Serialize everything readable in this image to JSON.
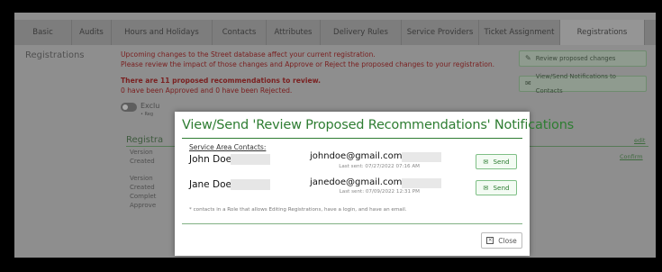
{
  "tabs": [
    "Basic",
    "Audits",
    "Hours and Holidays",
    "Contacts",
    "Attributes",
    "Delivery Rules",
    "Service Providers",
    "Ticket Assignment",
    "Registrations"
  ],
  "active_tab": "Registrations",
  "side_title": "Registrations",
  "warning": {
    "line1": "Upcoming changes to the Street database affect your current registration.",
    "line2": "Please review the impact of those changes and Approve or Reject the proposed changes to your registration.",
    "count_line": "There are 11 proposed recommendations to review.",
    "status_line": "0 have been Approved and 0 have been Rejected."
  },
  "buttons": {
    "review": "Review proposed changes",
    "notify": "View/Send Notifications to Contacts"
  },
  "background": {
    "exclude_label": "Exclu",
    "exclude_sub": "• Reg",
    "registration_heading": "Registra",
    "version_1": "Version",
    "created_1": "Created",
    "version_2": "Version",
    "created_2": "Created",
    "completed": "Complet",
    "approved": "Approve",
    "edit_link": "edit",
    "confirm_link": "Confirm"
  },
  "modal": {
    "title": "View/Send 'Review Proposed Recommendations' Notifications",
    "section_label": "Service Area Contacts:",
    "contacts": [
      {
        "name": "John Doe",
        "email": "johndoe@gmail.com",
        "last_sent": "Last sent: 07/27/2022 07:16 AM",
        "send_label": "Send"
      },
      {
        "name": "Jane Doe",
        "email": "janedoe@gmail.com",
        "last_sent": "Last sent: 07/09/2022 12:31 PM",
        "send_label": "Send"
      }
    ],
    "footnote": "* contacts in a Role that allows Editing Registrations, have a login, and have an email.",
    "close_label": "Close"
  },
  "colors": {
    "accent_green": "#2e7d32",
    "warning_red": "#7a2020",
    "overlay": "#8e8e8e"
  },
  "icons": {
    "review": "edit-icon",
    "notify": "envelope-icon",
    "send": "envelope-icon",
    "close": "close-box-icon"
  }
}
